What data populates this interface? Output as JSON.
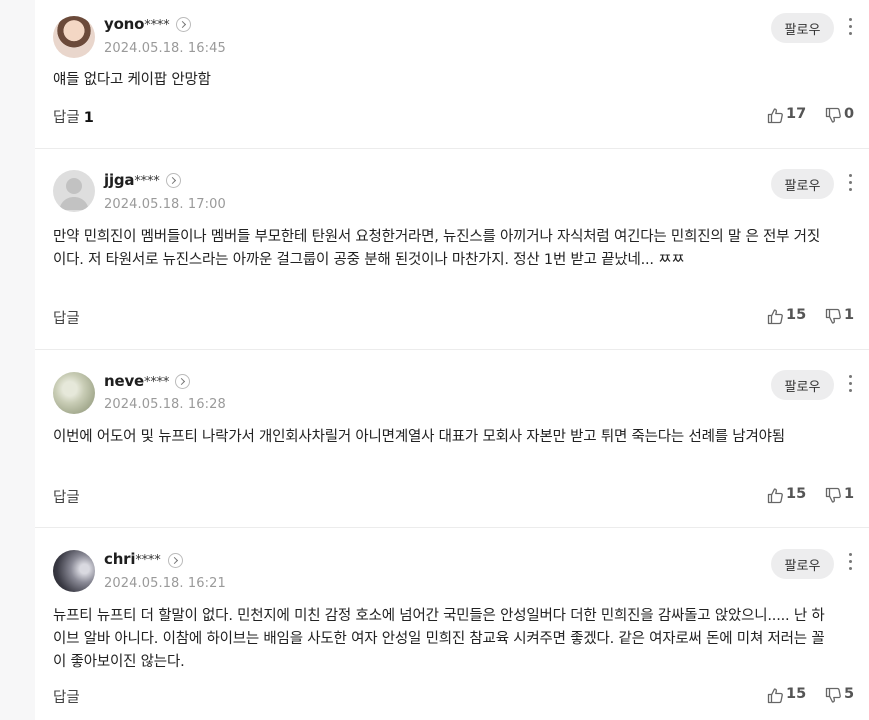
{
  "ui": {
    "follow_label": "팔로우",
    "reply_label": "답글"
  },
  "comments": [
    {
      "nick": "yono",
      "mask": "****",
      "date": "2024.05.18. 16:45",
      "text": "얘들 없다고 케이팝 안망함",
      "reply_count": "1",
      "likes": "17",
      "dislikes": "0"
    },
    {
      "nick": "jjga",
      "mask": "****",
      "date": "2024.05.18. 17:00",
      "text": "만약 민희진이 멤버들이나 멤버들 부모한테 탄원서 요청한거라면, 뉴진스를 아끼거나 자식처럼 여긴다는 민희진의 말 은 전부 거짓이다. 저 타원서로 뉴진스라는 아까운 걸그룹이 공중 분해 된것이나 마찬가지. 정산 1번 받고 끝났네... ㅉㅉ",
      "reply_count": "",
      "likes": "15",
      "dislikes": "1"
    },
    {
      "nick": "neve",
      "mask": "****",
      "date": "2024.05.18. 16:28",
      "text": "이번에 어도어 및 뉴프티 나락가서 개인회사차릴거 아니면계열사 대표가 모회사 자본만 받고 튀면 죽는다는 선례를 남겨야됨",
      "reply_count": "",
      "likes": "15",
      "dislikes": "1"
    },
    {
      "nick": "chri",
      "mask": "****",
      "date": "2024.05.18. 16:21",
      "text": "뉴프티 뉴프티 더 할말이 없다. 민천지에 미친 감정 호소에 넘어간 국민들은 안성일버다 더한 민희진을 감싸돌고 앉았으니..... 난 하이브 알바 아니다. 이참에 하이브는 배임을 사도한 여자 안성일 민희진 참교육 시켜주면 좋겠다. 같은 여자로써 돈에 미쳐 저러는 꼴이 좋아보이진 않는다.",
      "reply_count": "",
      "likes": "15",
      "dislikes": "5"
    }
  ]
}
